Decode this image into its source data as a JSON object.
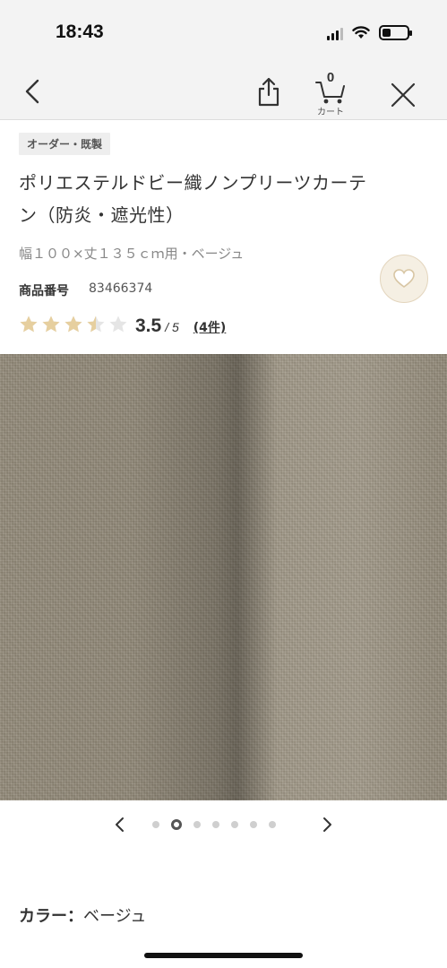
{
  "status_bar": {
    "time": "18:43",
    "battery_level": 0.35
  },
  "nav": {
    "cart_count": "0",
    "cart_label": "カート"
  },
  "product": {
    "tag": "オーダー・既製",
    "title_line1": "ポリエステルドビー織ノンプリーツカーテ",
    "title_line2": "ン（防炎・遮光性）",
    "variant": "幅１００×丈１３５ｃｍ用・ベージュ",
    "product_no_label": "商品番号",
    "product_no_value": "83466374"
  },
  "rating": {
    "value": "3.5",
    "max": "/ 5",
    "count": "(4件)",
    "stars": 3.5,
    "star_color": "#e6cf9f",
    "empty_star_color": "#e5e5e5"
  },
  "carousel": {
    "total": 7,
    "active_index": 1
  },
  "color": {
    "label": "カラー：",
    "value": "ベージュ"
  },
  "colors": {
    "fav_bg": "#f5efe3",
    "fabric": "#978e7c"
  }
}
